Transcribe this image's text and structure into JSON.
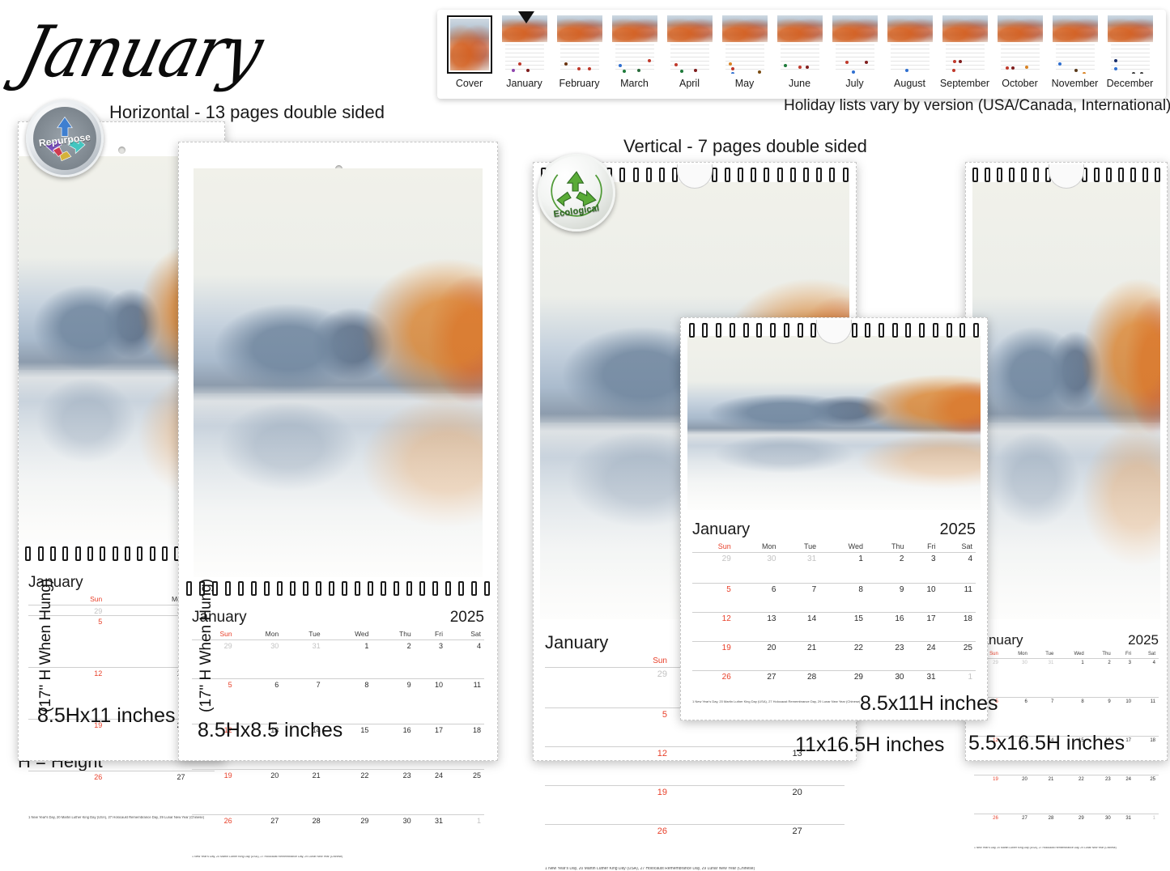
{
  "title": {
    "month_script": "January"
  },
  "captions": {
    "horizontal": "Horizontal - 13 pages double sided",
    "vertical": "Vertical - 7 pages double sided",
    "holiday_note": "Holiday lists vary by version (USA/Canada, International)",
    "height_key": "H = Height"
  },
  "badges": {
    "repurpose": {
      "label": "Repurpose",
      "icon": "recycle-arrows-icon"
    },
    "ecological": {
      "label": "Ecological",
      "icon": "recycle-icon",
      "color": "#3f8a2b"
    }
  },
  "filmstrip": {
    "selected": "Cover",
    "pointer_on": "January",
    "items": [
      {
        "label": "Cover"
      },
      {
        "label": "January"
      },
      {
        "label": "February"
      },
      {
        "label": "March"
      },
      {
        "label": "April"
      },
      {
        "label": "May"
      },
      {
        "label": "June"
      },
      {
        "label": "July"
      },
      {
        "label": "August"
      },
      {
        "label": "September"
      },
      {
        "label": "October"
      },
      {
        "label": "November"
      },
      {
        "label": "December"
      }
    ]
  },
  "calendar": {
    "month": "January",
    "year": "2025",
    "weekdays": [
      "Sun",
      "Mon",
      "Tue",
      "Wed",
      "Thu",
      "Fri",
      "Sat"
    ],
    "weeks": [
      [
        {
          "d": "29",
          "out": true
        },
        {
          "d": "30",
          "out": true
        },
        {
          "d": "31",
          "out": true
        },
        {
          "d": "1",
          "sticker": "fw"
        },
        {
          "d": "2"
        },
        {
          "d": "3"
        },
        {
          "d": "4"
        }
      ],
      [
        {
          "d": "5"
        },
        {
          "d": "6"
        },
        {
          "d": "7"
        },
        {
          "d": "8"
        },
        {
          "d": "9"
        },
        {
          "d": "10"
        },
        {
          "d": "11"
        }
      ],
      [
        {
          "d": "12"
        },
        {
          "d": "13"
        },
        {
          "d": "14"
        },
        {
          "d": "15"
        },
        {
          "d": "16"
        },
        {
          "d": "17"
        },
        {
          "d": "18"
        }
      ],
      [
        {
          "d": "19"
        },
        {
          "d": "20",
          "sticker": "mlk"
        },
        {
          "d": "21"
        },
        {
          "d": "22"
        },
        {
          "d": "23"
        },
        {
          "d": "24"
        },
        {
          "d": "25"
        }
      ],
      [
        {
          "d": "26"
        },
        {
          "d": "27",
          "sticker": "coin"
        },
        {
          "d": "28"
        },
        {
          "d": "29",
          "sticker": "dragon"
        },
        {
          "d": "30"
        },
        {
          "d": "31"
        },
        {
          "d": "1",
          "out": true
        }
      ]
    ],
    "footnote": "1 New Year's Day, 20 Martin Luther King Day (USA), 27 Holocaust Remembrance Day, 29 Lunar New Year (Chinese)",
    "sunday_color": "#e8402a"
  },
  "products": [
    {
      "id": "h-1",
      "side_label": "(17\" H When Hung)",
      "size_label": "8.5Hx11 inches",
      "orientation": "horizontal"
    },
    {
      "id": "h-2",
      "side_label": "(17\" H When Hung)",
      "size_label": "8.5Hx8.5 inches",
      "orientation": "horizontal"
    },
    {
      "id": "v-1",
      "side_label": "",
      "size_label": "11x16.5H inches",
      "orientation": "vertical"
    },
    {
      "id": "v-2",
      "side_label": "",
      "size_label": "8.5x11H inches",
      "orientation": "vertical"
    },
    {
      "id": "v-3",
      "side_label": "",
      "size_label": "5.5x16.5H inches",
      "orientation": "vertical"
    }
  ]
}
